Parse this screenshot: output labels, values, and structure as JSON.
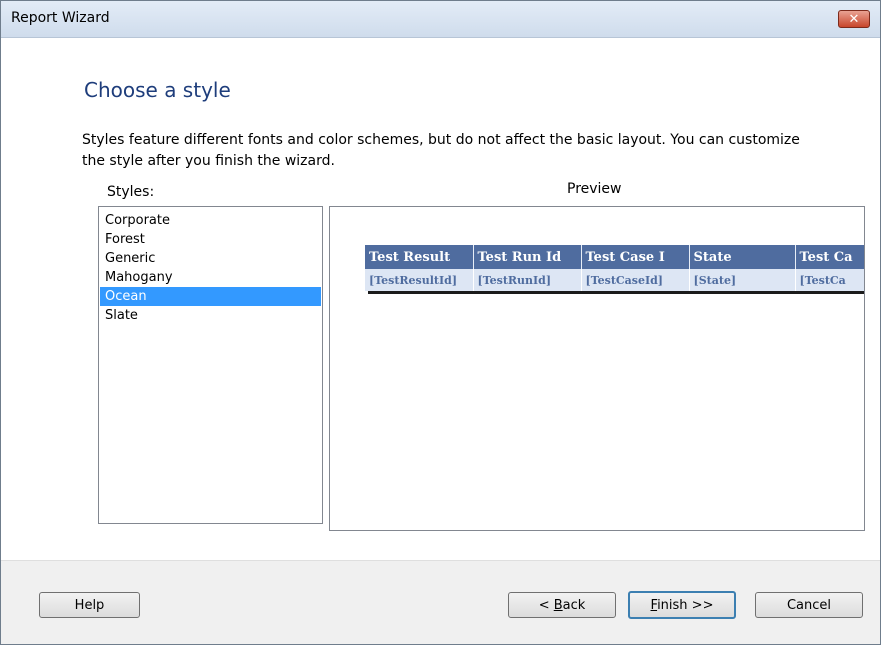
{
  "window": {
    "title": "Report Wizard",
    "close_glyph": "✕"
  },
  "page": {
    "heading": "Choose a style",
    "description": "Styles feature different fonts and color schemes, but do not affect the basic layout. You can customize the style after you finish the wizard."
  },
  "styles": {
    "label": "Styles:",
    "items": [
      "Corporate",
      "Forest",
      "Generic",
      "Mahogany",
      "Ocean",
      "Slate"
    ],
    "selected_index": 4
  },
  "preview": {
    "label": "Preview",
    "headers": [
      "Test Result",
      "Test Run Id",
      "Test Case I",
      "State",
      "Test Ca"
    ],
    "row": [
      "[TestResultId]",
      "[TestRunId]",
      "[TestCaseId]",
      "[State]",
      "[TestCa"
    ],
    "header_color": "#4f6c9f",
    "row_color": "#dde6f4"
  },
  "buttons": {
    "help": "Help",
    "back_prefix": "< ",
    "back_mnemonic": "B",
    "back_rest": "ack",
    "finish_mnemonic": "F",
    "finish_rest": "inish >>",
    "cancel": "Cancel"
  },
  "colors": {
    "heading": "#1e3d7b",
    "selection": "#3399ff"
  }
}
